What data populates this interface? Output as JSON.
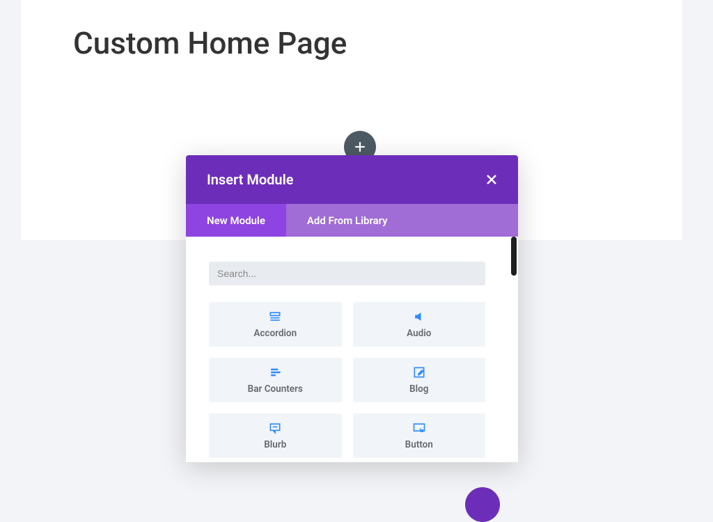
{
  "page": {
    "title": "Custom Home Page"
  },
  "modal": {
    "title": "Insert Module",
    "tabs": {
      "new": "New Module",
      "library": "Add From Library"
    },
    "search": {
      "placeholder": "Search..."
    },
    "modules": {
      "accordion": "Accordion",
      "audio": "Audio",
      "bar_counters": "Bar Counters",
      "blog": "Blog",
      "blurb": "Blurb",
      "button": "Button"
    }
  }
}
